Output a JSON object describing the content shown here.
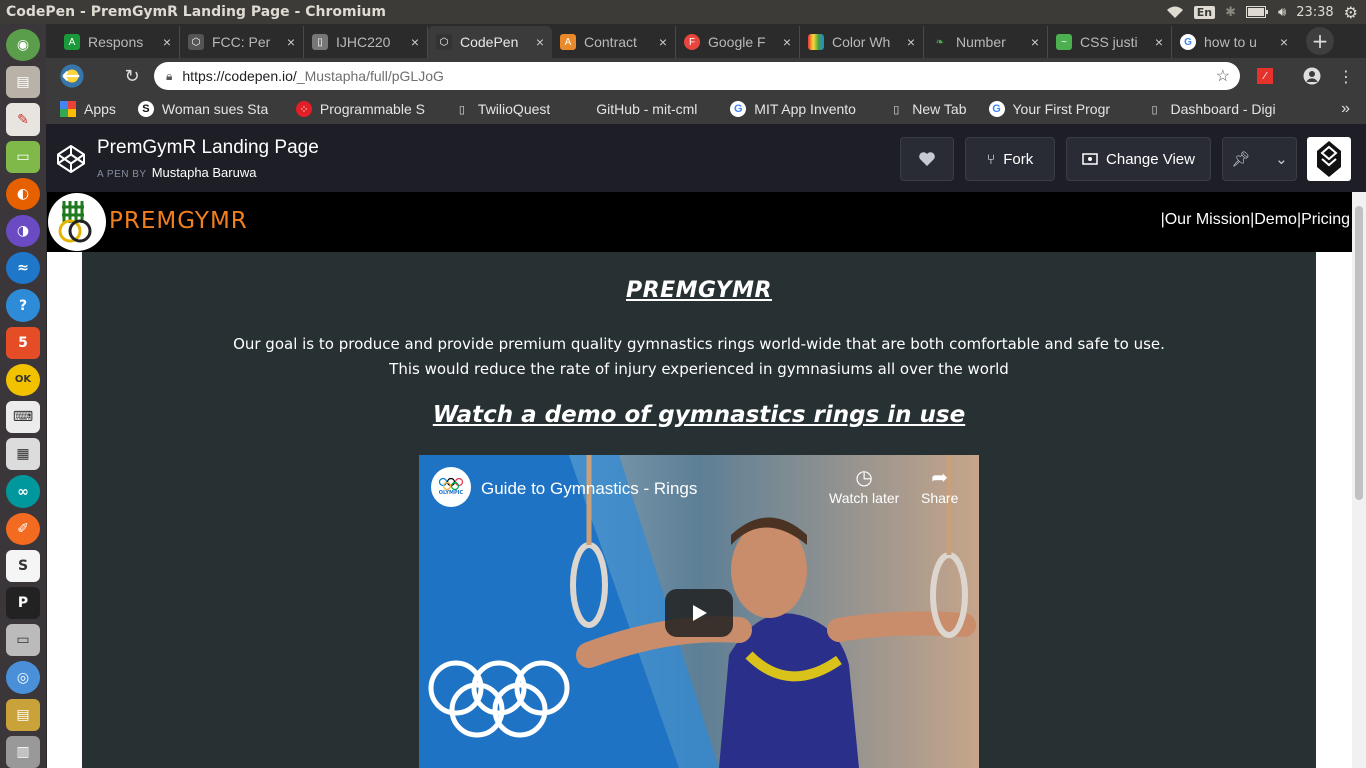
{
  "os": {
    "window_title": "CodePen - PremGymR Landing Page - Chromium",
    "keyboard_layout": "En",
    "clock": "23:38"
  },
  "launcher": {
    "icons": [
      "dash-home-icon",
      "files-icon",
      "document-viewer-icon",
      "terminal-icon",
      "firefox-icon",
      "firefox-dev-icon",
      "browser-icon",
      "help-icon",
      "html5-icon",
      "ok-icon",
      "keyboard-icon",
      "calculator-icon",
      "arduino-icon",
      "sketch-icon",
      "slack-icon",
      "pycharm-icon",
      "drive-icon",
      "chromium-icon",
      "archive-icon",
      "trash-icon"
    ]
  },
  "tabs": [
    {
      "label": "Respons",
      "fav_color": "#1a9a3a",
      "fav": "A"
    },
    {
      "label": "FCC: Per",
      "fav_color": "#555555",
      "fav": "⬡"
    },
    {
      "label": "IJHC220",
      "fav_color": "#777777",
      "fav": "▯"
    },
    {
      "label": "CodePen",
      "fav_color": "#333333",
      "fav": "⬡",
      "active": true
    },
    {
      "label": "Contract",
      "fav_color": "#e88a2a",
      "fav": "A"
    },
    {
      "label": "Google F",
      "fav_color": "#e8453c",
      "fav": "F"
    },
    {
      "label": "Color Wh",
      "fav_color": "#2b7de9",
      "fav": "▦"
    },
    {
      "label": "Number",
      "fav_color": "#4caf50",
      "fav": "❧"
    },
    {
      "label": "CSS justi",
      "fav_color": "#4caf50",
      "fav": "~"
    },
    {
      "label": "how to u",
      "fav_color": "#ffffff",
      "fav": "G"
    }
  ],
  "omnibox": {
    "url_host": "https://codepen.io/",
    "url_path": "_Mustapha/full/pGLJoG"
  },
  "bookmarks": [
    {
      "label": "Apps",
      "icon": "apps-icon"
    },
    {
      "label": "Woman sues Sta",
      "icon": "s-icon"
    },
    {
      "label": "Programmable S",
      "icon": "twilio-icon"
    },
    {
      "label": "TwilioQuest",
      "icon": "page-icon"
    },
    {
      "label": "GitHub - mit-cml",
      "icon": "github-icon"
    },
    {
      "label": "MIT App Invento",
      "icon": "google-icon"
    },
    {
      "label": "New Tab",
      "icon": "page-icon"
    },
    {
      "label": "Your First Progr",
      "icon": "google-icon"
    },
    {
      "label": "Dashboard - Digi",
      "icon": "page-icon"
    }
  ],
  "codepen": {
    "pen_title": "PremGymR Landing Page",
    "pen_by": "A PEN BY",
    "author": "Mustapha Baruwa",
    "fork_label": "Fork",
    "change_view_label": "Change View"
  },
  "site": {
    "brand": "PREMGYMR",
    "nav_links": [
      "|Our Mission",
      "|Demo",
      "|Pricing"
    ],
    "heading": "PREMGYMR",
    "goal_line1": "Our goal is to produce and provide premium quality gymnastics rings world-wide that are both comfortable and safe to use.",
    "goal_line2": "This would reduce the rate of injury experienced in gymnasiums all over the world",
    "demo_heading": "Watch a demo of gymnastics rings in use",
    "video": {
      "title": "Guide to Gymnastics - Rings",
      "channel_text": "OLYMPIC",
      "watch_later": "Watch later",
      "share": "Share"
    }
  },
  "colors": {
    "brand_orange": "#f07f1f",
    "content_bg": "#273033",
    "codepen_header": "#1e1f26"
  }
}
